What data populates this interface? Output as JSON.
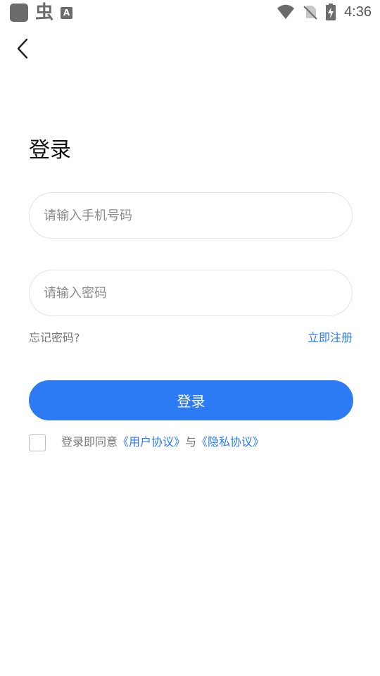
{
  "status": {
    "time": "4:36",
    "app_glyph": "虫",
    "a_label": "A"
  },
  "page": {
    "title": "登录"
  },
  "form": {
    "phone_placeholder": "请输入手机号码",
    "password_placeholder": "请输入密码",
    "forgot": "忘记密码?",
    "register": "立即注册",
    "login_button": "登录"
  },
  "agreement": {
    "prefix": "登录即同意",
    "user_agreement": "《用户协议》",
    "conjunction": "与",
    "privacy_policy": "《隐私协议》"
  },
  "colors": {
    "accent": "#2d7bf4",
    "status_icon": "#6b6b6b"
  },
  "icons": [
    "back-arrow-icon",
    "wifi-icon",
    "no-sim-icon",
    "battery-charging-icon",
    "app-icon",
    "bug-icon",
    "a-box-icon"
  ]
}
